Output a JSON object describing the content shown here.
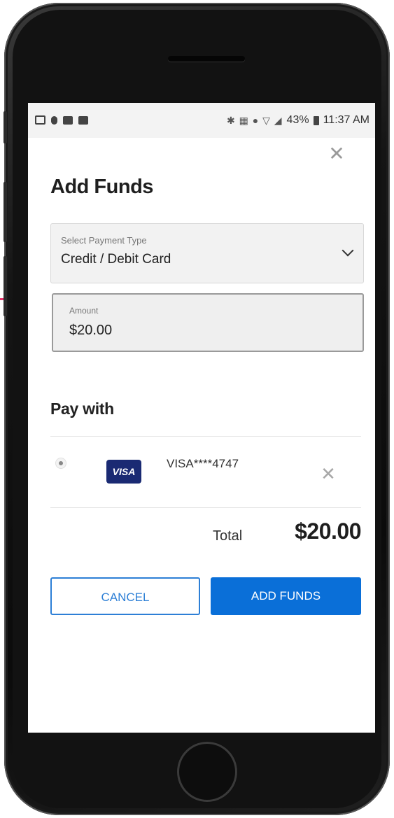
{
  "statusbar": {
    "time": "11:37 AM",
    "battery": "43%",
    "glyphs": "✱ ▦ ● ▽ ◢"
  },
  "dialog": {
    "title": "Add Funds",
    "close_icon": "✕"
  },
  "payment_type": {
    "label": "Select Payment Type",
    "value": "Credit / Debit Card"
  },
  "amount": {
    "label": "Amount",
    "value": "$20.00"
  },
  "pay_with": {
    "heading": "Pay with",
    "card_brand": "VISA",
    "card_number": "VISA****4747",
    "remove_icon": "✕"
  },
  "total": {
    "label": "Total",
    "value": "$20.00"
  },
  "actions": {
    "cancel_label": "CANCEL",
    "add_label": "ADD FUNDS"
  },
  "colors": {
    "primary": "#0a6fd8",
    "outline": "#2d7fd6",
    "visa": "#1a2a73"
  }
}
